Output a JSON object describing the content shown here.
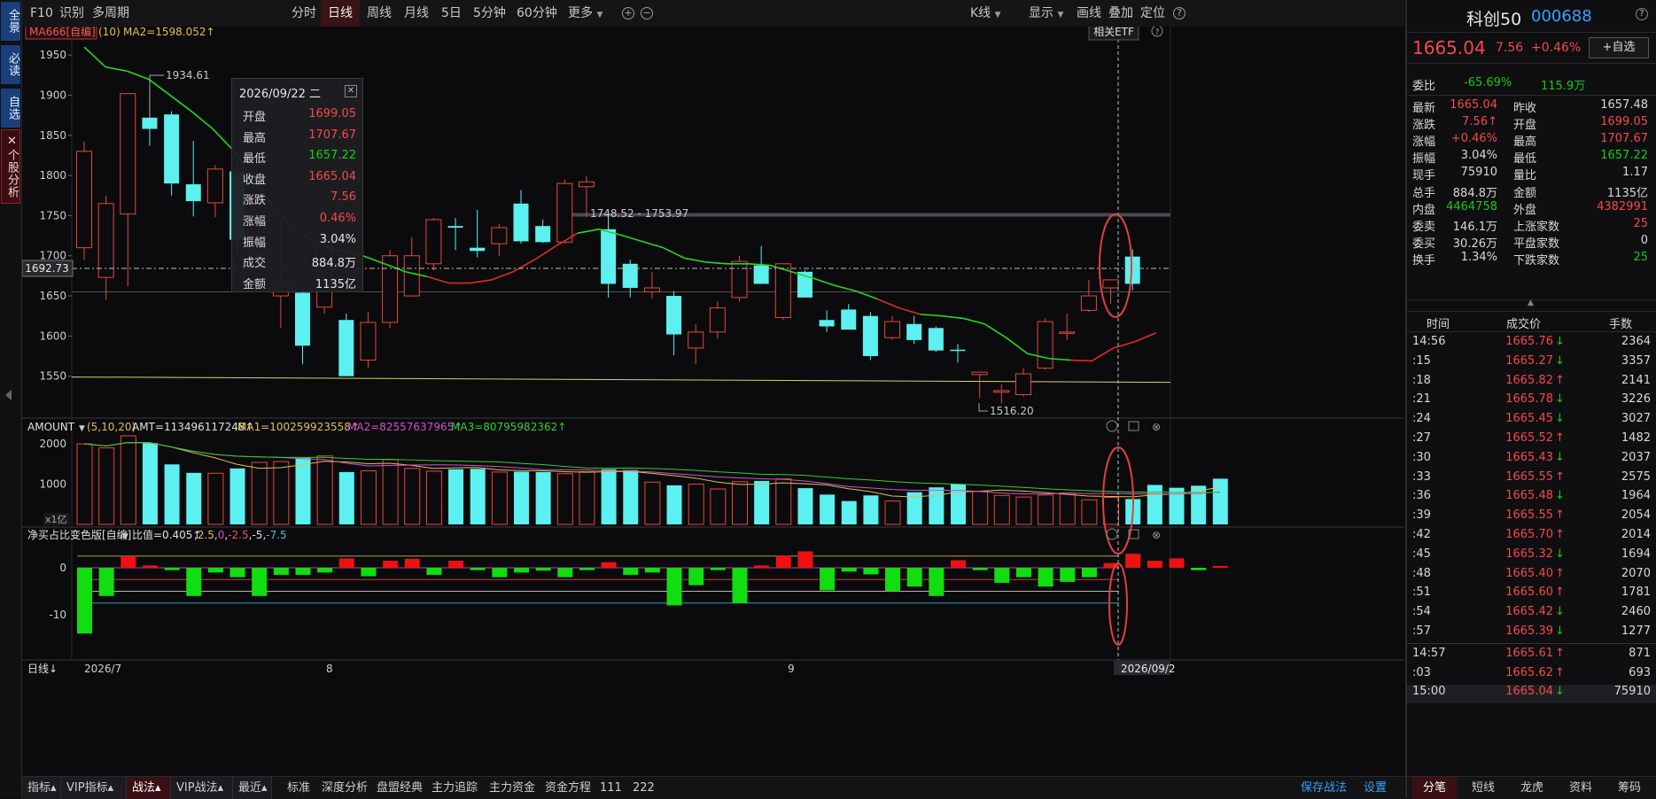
{
  "left_strip": {
    "items": [
      "全景",
      "必读",
      "自选",
      "个股分析"
    ],
    "close_glyph": "✕"
  },
  "toolbar": {
    "left": [
      "F10",
      "识别",
      "多周期"
    ],
    "periods": [
      "分时",
      "日线",
      "周线",
      "月线",
      "5日",
      "5分钟",
      "60分钟",
      "更多"
    ],
    "active_period": "日线",
    "right": [
      "K线",
      "显示",
      "画线",
      "叠加",
      "定位"
    ],
    "zoom_in": "+",
    "zoom_out": "−",
    "help": "?"
  },
  "main_indicator": {
    "name": "MA666[自编]",
    "param": "(10)",
    "ma2_label": "MA2=1598.052↑",
    "etf_button": "相关ETF",
    "help": "?"
  },
  "price_axis": {
    "labels": [
      "1950",
      "1900",
      "1850",
      "1800",
      "1750",
      "1700",
      "1650",
      "1600",
      "1550"
    ],
    "ymin": 1500,
    "ymax": 1970
  },
  "crosshair_price": "1692.73",
  "annotations": {
    "high_label": "1934.61",
    "low_label": "1516.20",
    "range_label": "1748.52 - 1753.97"
  },
  "tooltip": {
    "date": "2026/09/22 二",
    "close_icon": "✕",
    "rows": [
      {
        "k": "开盘",
        "v": "1699.05",
        "c": "red"
      },
      {
        "k": "最高",
        "v": "1707.67",
        "c": "red"
      },
      {
        "k": "最低",
        "v": "1657.22",
        "c": "green"
      },
      {
        "k": "收盘",
        "v": "1665.04",
        "c": "red"
      },
      {
        "k": "涨跌",
        "v": "7.56",
        "c": "red"
      },
      {
        "k": "涨幅",
        "v": "0.46%",
        "c": "red"
      },
      {
        "k": "振幅",
        "v": "3.04%",
        "c": "white"
      },
      {
        "k": "成交",
        "v": "884.8万",
        "c": "white"
      },
      {
        "k": "金额",
        "v": "1135亿",
        "c": "white"
      }
    ]
  },
  "candles": [
    {
      "o": 1710,
      "h": 1842,
      "l": 1695,
      "c": 1830
    },
    {
      "o": 1673,
      "h": 1775,
      "l": 1645,
      "c": 1765
    },
    {
      "o": 1752,
      "h": 1902,
      "l": 1662,
      "c": 1902
    },
    {
      "o": 1872,
      "h": 1905,
      "l": 1837,
      "c": 1858
    },
    {
      "o": 1876,
      "h": 1880,
      "l": 1775,
      "c": 1790
    },
    {
      "o": 1789,
      "h": 1843,
      "l": 1749,
      "c": 1768
    },
    {
      "o": 1766,
      "h": 1813,
      "l": 1748,
      "c": 1808
    },
    {
      "o": 1805,
      "h": 1813,
      "l": 1705,
      "c": 1720
    },
    {
      "o": 1700,
      "h": 1740,
      "l": 1690,
      "c": 1702
    },
    {
      "o": 1650,
      "h": 1745,
      "l": 1610,
      "c": 1668
    },
    {
      "o": 1654,
      "h": 1665,
      "l": 1565,
      "c": 1588
    },
    {
      "o": 1636,
      "h": 1720,
      "l": 1628,
      "c": 1720
    },
    {
      "o": 1620,
      "h": 1628,
      "l": 1550,
      "c": 1550
    },
    {
      "o": 1570,
      "h": 1630,
      "l": 1560,
      "c": 1617
    },
    {
      "o": 1617,
      "h": 1707,
      "l": 1610,
      "c": 1700
    },
    {
      "o": 1650,
      "h": 1723,
      "l": 1649,
      "c": 1700
    },
    {
      "o": 1690,
      "h": 1747,
      "l": 1682,
      "c": 1745
    },
    {
      "o": 1737,
      "h": 1747,
      "l": 1707,
      "c": 1735
    },
    {
      "o": 1710,
      "h": 1757,
      "l": 1698,
      "c": 1706
    },
    {
      "o": 1715,
      "h": 1740,
      "l": 1700,
      "c": 1735
    },
    {
      "o": 1765,
      "h": 1782,
      "l": 1715,
      "c": 1718
    },
    {
      "o": 1737,
      "h": 1745,
      "l": 1716,
      "c": 1717
    },
    {
      "o": 1717,
      "h": 1795,
      "l": 1715,
      "c": 1790
    },
    {
      "o": 1786,
      "h": 1799,
      "l": 1748,
      "c": 1792
    },
    {
      "o": 1733,
      "h": 1753,
      "l": 1648,
      "c": 1665
    },
    {
      "o": 1690,
      "h": 1695,
      "l": 1648,
      "c": 1660
    },
    {
      "o": 1655,
      "h": 1680,
      "l": 1647,
      "c": 1660
    },
    {
      "o": 1650,
      "h": 1656,
      "l": 1576,
      "c": 1602
    },
    {
      "o": 1585,
      "h": 1615,
      "l": 1565,
      "c": 1605
    },
    {
      "o": 1605,
      "h": 1643,
      "l": 1597,
      "c": 1635
    },
    {
      "o": 1648,
      "h": 1700,
      "l": 1643,
      "c": 1693
    },
    {
      "o": 1688,
      "h": 1712,
      "l": 1665,
      "c": 1665
    },
    {
      "o": 1623,
      "h": 1690,
      "l": 1620,
      "c": 1690
    },
    {
      "o": 1680,
      "h": 1682,
      "l": 1648,
      "c": 1648
    },
    {
      "o": 1620,
      "h": 1632,
      "l": 1605,
      "c": 1612
    },
    {
      "o": 1633,
      "h": 1640,
      "l": 1608,
      "c": 1608
    },
    {
      "o": 1625,
      "h": 1630,
      "l": 1570,
      "c": 1575
    },
    {
      "o": 1598,
      "h": 1625,
      "l": 1595,
      "c": 1618
    },
    {
      "o": 1615,
      "h": 1625,
      "l": 1590,
      "c": 1595
    },
    {
      "o": 1610,
      "h": 1612,
      "l": 1580,
      "c": 1582
    },
    {
      "o": 1583,
      "h": 1590,
      "l": 1567,
      "c": 1582
    },
    {
      "o": 1552,
      "h": 1555,
      "l": 1523,
      "c": 1555
    },
    {
      "o": 1530,
      "h": 1540,
      "l": 1516,
      "c": 1532
    },
    {
      "o": 1527,
      "h": 1560,
      "l": 1525,
      "c": 1553
    },
    {
      "o": 1560,
      "h": 1622,
      "l": 1558,
      "c": 1618
    },
    {
      "o": 1605,
      "h": 1628,
      "l": 1595,
      "c": 1605
    },
    {
      "o": 1632,
      "h": 1670,
      "l": 1630,
      "c": 1650
    },
    {
      "o": 1660,
      "h": 1667,
      "l": 1640,
      "c": 1670
    },
    {
      "o": 1699,
      "h": 1708,
      "l": 1657,
      "c": 1665
    }
  ],
  "ma_line": [
    1960,
    1935,
    1930,
    1920,
    1900,
    1880,
    1858,
    1830,
    1790,
    1755,
    1730,
    1713,
    1706,
    1700,
    1690,
    1680,
    1674,
    1666,
    1666,
    1670,
    1680,
    1695,
    1712,
    1728,
    1733,
    1726,
    1718,
    1710,
    1697,
    1692,
    1690,
    1690,
    1688,
    1680,
    1672,
    1663,
    1656,
    1646,
    1635,
    1627,
    1625,
    1622,
    1615,
    1598,
    1578,
    1572,
    1570,
    1569,
    1585,
    1593,
    1604
  ],
  "ma_colors": [
    "g",
    "g",
    "g",
    "g",
    "g",
    "g",
    "g",
    "g",
    "g",
    "g",
    "g",
    "g",
    "g",
    "g",
    "g",
    "g",
    "r",
    "r",
    "r",
    "r",
    "r",
    "r",
    "r",
    "g",
    "g",
    "g",
    "g",
    "g",
    "g",
    "g",
    "g",
    "g",
    "g",
    "g",
    "g",
    "g",
    "g",
    "r",
    "r",
    "g",
    "g",
    "g",
    "g",
    "g",
    "g",
    "g",
    "r",
    "r",
    "r",
    "r",
    "r"
  ],
  "h_lines": {
    "support": 1549,
    "resistance": 1751,
    "mid": 1655
  },
  "amount_panel": {
    "name": "AMOUNT",
    "params": "(5,10,20)",
    "amt": "AMT=113496117248↑",
    "ma1": "MA1=100259923558↑",
    "ma2": "MA2=82557637965↑",
    "ma3": "MA3=80795982362↑",
    "axis": [
      "2000",
      "1000"
    ],
    "unit": "x1亿",
    "ymax": 2200,
    "values": [
      2000,
      1900,
      2200,
      2020,
      1490,
      1280,
      1270,
      1390,
      1540,
      1560,
      1650,
      1700,
      1300,
      1330,
      1610,
      1390,
      1320,
      1370,
      1380,
      1300,
      1310,
      1300,
      1260,
      1310,
      1370,
      1350,
      1050,
      970,
      1000,
      880,
      1060,
      1080,
      1130,
      900,
      740,
      580,
      720,
      580,
      800,
      920,
      1000,
      820,
      720,
      680,
      730,
      780,
      610,
      670,
      630,
      980,
      910,
      960,
      1135
    ]
  },
  "netbuy_panel": {
    "name": "净买占比变色版[自编]",
    "params": "比值=0.405↑",
    "p2": "2.5",
    "p3": "0",
    "p4": "-2.5",
    "p5": "-5",
    "p6": "-7.5",
    "axis": [
      "0",
      "-10"
    ],
    "values": [
      -14,
      -6,
      2.5,
      0.5,
      -0.5,
      -6,
      -1,
      -2,
      -6,
      -1.5,
      -1.5,
      -1,
      2,
      -1.8,
      1.5,
      1.9,
      -1.5,
      1.5,
      -0.5,
      -2,
      -1,
      -0.6,
      -2,
      -0.5,
      1.2,
      -1.5,
      -1,
      -8,
      -3.7,
      -0.5,
      -7.5,
      0.5,
      2.6,
      3.5,
      -4.8,
      -0.8,
      -1.4,
      -5,
      -4,
      -6,
      1.6,
      -0.5,
      -3.2,
      -2,
      -4,
      -3,
      -2,
      1,
      3,
      1.5,
      2,
      -0.5,
      0.4
    ]
  },
  "x_axis": {
    "labels": [
      "2026/7",
      "8",
      "9"
    ],
    "cursor_date": "2026/09/2",
    "period_tag": "日线↓"
  },
  "right_panel": {
    "name": "科创50",
    "code": "000688",
    "price": "1665.04",
    "change": "7.56",
    "pct": "+0.46%",
    "fav_button": "+自选",
    "weibi_label": "委比",
    "weibi": "-65.69%",
    "weicha": "115.9万",
    "quote_rows": [
      [
        {
          "t": "最新",
          "c": "w"
        },
        {
          "t": "1665.04",
          "c": "r"
        },
        {
          "t": "昨收",
          "c": "w"
        },
        {
          "t": "1657.48",
          "c": "w"
        }
      ],
      [
        {
          "t": "涨跌",
          "c": "w"
        },
        {
          "t": "7.56↑",
          "c": "r"
        },
        {
          "t": "开盘",
          "c": "w"
        },
        {
          "t": "1699.05",
          "c": "r"
        }
      ],
      [
        {
          "t": "涨幅",
          "c": "w"
        },
        {
          "t": "+0.46%",
          "c": "r"
        },
        {
          "t": "最高",
          "c": "w"
        },
        {
          "t": "1707.67",
          "c": "r"
        }
      ],
      [
        {
          "t": "振幅",
          "c": "w"
        },
        {
          "t": "3.04%",
          "c": "w"
        },
        {
          "t": "最低",
          "c": "w"
        },
        {
          "t": "1657.22",
          "c": "g"
        }
      ],
      [
        {
          "t": "现手",
          "c": "w"
        },
        {
          "t": "75910",
          "c": "w"
        },
        {
          "t": "量比",
          "c": "w"
        },
        {
          "t": "1.17",
          "c": "w"
        }
      ],
      [
        {
          "t": "总手",
          "c": "w"
        },
        {
          "t": "884.8万",
          "c": "w"
        },
        {
          "t": "金额",
          "c": "w"
        },
        {
          "t": "1135亿",
          "c": "w"
        }
      ],
      [
        {
          "t": "内盘",
          "c": "w"
        },
        {
          "t": "4464758",
          "c": "g"
        },
        {
          "t": "外盘",
          "c": "w"
        },
        {
          "t": "4382991",
          "c": "r"
        }
      ],
      [
        {
          "t": "委卖",
          "c": "w"
        },
        {
          "t": "146.1万",
          "c": "w"
        },
        {
          "t": "上涨家数",
          "c": "w"
        },
        {
          "t": "25",
          "c": "r"
        }
      ],
      [
        {
          "t": "委买",
          "c": "w"
        },
        {
          "t": "30.26万",
          "c": "w"
        },
        {
          "t": "平盘家数",
          "c": "w"
        },
        {
          "t": "0",
          "c": "w"
        }
      ],
      [
        {
          "t": "换手",
          "c": "w"
        },
        {
          "t": "1.34%",
          "c": "w"
        },
        {
          "t": "下跌家数",
          "c": "w"
        },
        {
          "t": "25",
          "c": "g"
        }
      ]
    ],
    "trade_headers": [
      "时间",
      "成交价",
      "手数"
    ],
    "trades": [
      {
        "t": "14:56",
        "p": "1665.76",
        "d": "↓",
        "q": "2364"
      },
      {
        "t": ":15",
        "p": "1665.27",
        "d": "↓",
        "q": "3357"
      },
      {
        "t": ":18",
        "p": "1665.82",
        "d": "↑",
        "q": "2141"
      },
      {
        "t": ":21",
        "p": "1665.78",
        "d": "↓",
        "q": "3226"
      },
      {
        "t": ":24",
        "p": "1665.45",
        "d": "↓",
        "q": "3027"
      },
      {
        "t": ":27",
        "p": "1665.52",
        "d": "↑",
        "q": "1482"
      },
      {
        "t": ":30",
        "p": "1665.43",
        "d": "↓",
        "q": "2037"
      },
      {
        "t": ":33",
        "p": "1665.55",
        "d": "↑",
        "q": "2575"
      },
      {
        "t": ":36",
        "p": "1665.48",
        "d": "↓",
        "q": "1964"
      },
      {
        "t": ":39",
        "p": "1665.55",
        "d": "↑",
        "q": "2054"
      },
      {
        "t": ":42",
        "p": "1665.70",
        "d": "↑",
        "q": "2014"
      },
      {
        "t": ":45",
        "p": "1665.32",
        "d": "↓",
        "q": "1694"
      },
      {
        "t": ":48",
        "p": "1665.40",
        "d": "↑",
        "q": "2070"
      },
      {
        "t": ":51",
        "p": "1665.60",
        "d": "↑",
        "q": "1781"
      },
      {
        "t": ":54",
        "p": "1665.42",
        "d": "↓",
        "q": "2460"
      },
      {
        "t": ":57",
        "p": "1665.39",
        "d": "↓",
        "q": "1277"
      },
      {
        "t": "14:57",
        "p": "1665.61",
        "d": "↑",
        "q": "871"
      },
      {
        "t": ":03",
        "p": "1665.62",
        "d": "↑",
        "q": "693"
      },
      {
        "t": "15:00",
        "p": "1665.04",
        "d": "↓",
        "q": "75910"
      }
    ],
    "bottom_tabs": [
      "分笔",
      "短线",
      "龙虎",
      "资料",
      "筹码"
    ],
    "active_tab": "分笔"
  },
  "bottom_bar": {
    "tabs": [
      "指标▴",
      "VIP指标▴",
      "战法▴",
      "VIP战法▴",
      "最近▴"
    ],
    "active_tab": "战法▴",
    "links": [
      "标准",
      "深度分析",
      "盘盟经典",
      "主力追踪",
      "主力资金",
      "资金方程",
      "111",
      "222"
    ],
    "save": "保存战法",
    "settings": "设置"
  }
}
